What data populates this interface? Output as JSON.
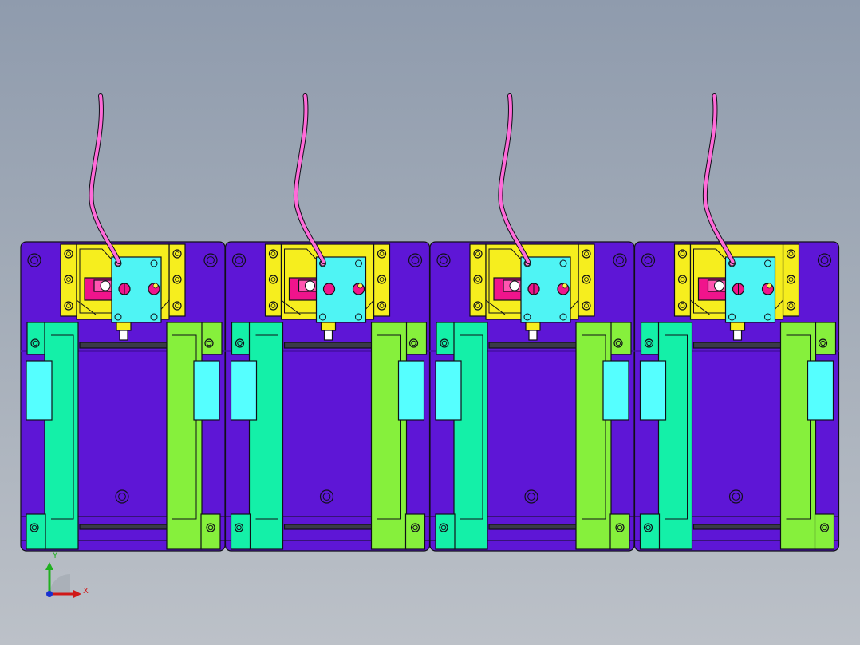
{
  "viewport": {
    "background_top": "#8f9bad",
    "background_bottom": "#bcc1c8"
  },
  "model": {
    "station_count": 4,
    "colors": {
      "base_plate": "#5e16d6",
      "base_plate_dark": "#4b10b0",
      "outline": "#101018",
      "yellow_bracket": "#f6ee1e",
      "cyan_block": "#4ff4f4",
      "magenta_slider": "#f0148c",
      "teal_clamp": "#14f0a8",
      "lime_clamp": "#86f03c",
      "cyan_pad": "#55ffff",
      "cable": "#ff6ad8",
      "rail": "#3a3a48"
    }
  },
  "triad": {
    "x_label": "X",
    "y_label": "Y",
    "x_color": "#d01818",
    "y_color": "#20b020",
    "z_color": "#1830d0"
  }
}
